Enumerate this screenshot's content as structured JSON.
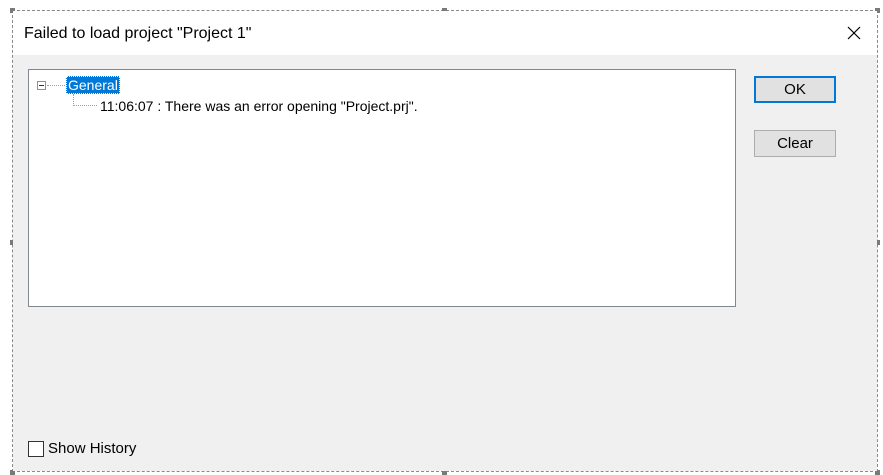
{
  "window": {
    "title": "Failed to load project \"Project 1\"",
    "close_icon": "close-icon"
  },
  "tree": {
    "root_label": "General",
    "root_expanded": true,
    "children": [
      {
        "label": "11:06:07 : There was an error opening \"Project.prj\"."
      }
    ]
  },
  "buttons": {
    "ok_label": "OK",
    "clear_label": "Clear"
  },
  "footer": {
    "show_history_label": "Show History",
    "show_history_checked": false
  },
  "colors": {
    "selection": "#0078d7",
    "client_bg": "#f0f0f0",
    "button_bg": "#e1e1e1"
  }
}
